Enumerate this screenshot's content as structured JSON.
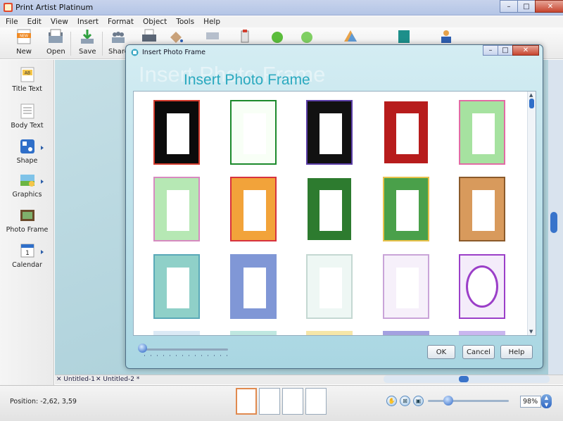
{
  "app": {
    "title": "Print Artist Platinum",
    "window_controls": {
      "minimize": "–",
      "maximize": "□",
      "close": "✕"
    }
  },
  "menu": [
    "File",
    "Edit",
    "View",
    "Insert",
    "Format",
    "Object",
    "Tools",
    "Help"
  ],
  "toolbar": {
    "new": "New",
    "open": "Open",
    "save": "Save",
    "share": "Share"
  },
  "left_panel": {
    "title_text": "Title Text",
    "body_text": "Body Text",
    "shape": "Shape",
    "graphics": "Graphics",
    "photo_frame": "Photo Frame",
    "calendar": "Calendar"
  },
  "dialog": {
    "title": "Insert Photo Frame",
    "header_ghost": "Insert Photo Frame",
    "header": "Insert Photo Frame",
    "ok": "OK",
    "cancel": "Cancel",
    "help": "Help",
    "window_controls": {
      "minimize": "–",
      "maximize": "□",
      "close": "✕"
    }
  },
  "frames": [
    {
      "name": "frame-black-red-vines",
      "bg": "#0b0b0b",
      "accent": "#d23a2c"
    },
    {
      "name": "frame-white-green-vines",
      "bg": "#f8fff6",
      "accent": "#1c8a2c"
    },
    {
      "name": "frame-black-presents",
      "bg": "#111111",
      "accent": "#5b3ea8"
    },
    {
      "name": "frame-red-snowmen",
      "bg": "#b71c1c",
      "accent": "#ffffff"
    },
    {
      "name": "frame-green-pink-border",
      "bg": "#a6e2a0",
      "accent": "#e26ba4"
    },
    {
      "name": "frame-mint-dotted",
      "bg": "#b6e8b4",
      "accent": "#d78ac0"
    },
    {
      "name": "frame-faces-cartoon",
      "bg": "#f2a33a",
      "accent": "#d7323e"
    },
    {
      "name": "frame-dark-green-vine",
      "bg": "#2d7b2f",
      "accent": "#ffffff"
    },
    {
      "name": "frame-farm-scene",
      "bg": "#4aa04a",
      "accent": "#e8c14a"
    },
    {
      "name": "frame-teddy-bears",
      "bg": "#d89a5c",
      "accent": "#8b5a2b"
    },
    {
      "name": "frame-teal-swirls",
      "bg": "#8fd0c8",
      "accent": "#5aa9b8"
    },
    {
      "name": "frame-periwinkle-plain",
      "bg": "#8097d6",
      "accent": "#8097d6"
    },
    {
      "name": "frame-light-floral",
      "bg": "#eef7f4",
      "accent": "#c4d8d2"
    },
    {
      "name": "frame-pastel-confetti",
      "bg": "#f6f0fa",
      "accent": "#c9a4d8"
    },
    {
      "name": "frame-purple-oval",
      "bg": "#f4ecfa",
      "accent": "#9b3fc8"
    }
  ],
  "tabs": {
    "doc1": "Untitled-1",
    "doc2": "Untitled-2 *"
  },
  "status": {
    "position": "Position: -2,62, 3,59",
    "zoom": "98%"
  },
  "colors": {
    "accent": "#2f6fc9",
    "dialog_bg": "#bfe2ea",
    "header_text": "#2aa9bf"
  }
}
